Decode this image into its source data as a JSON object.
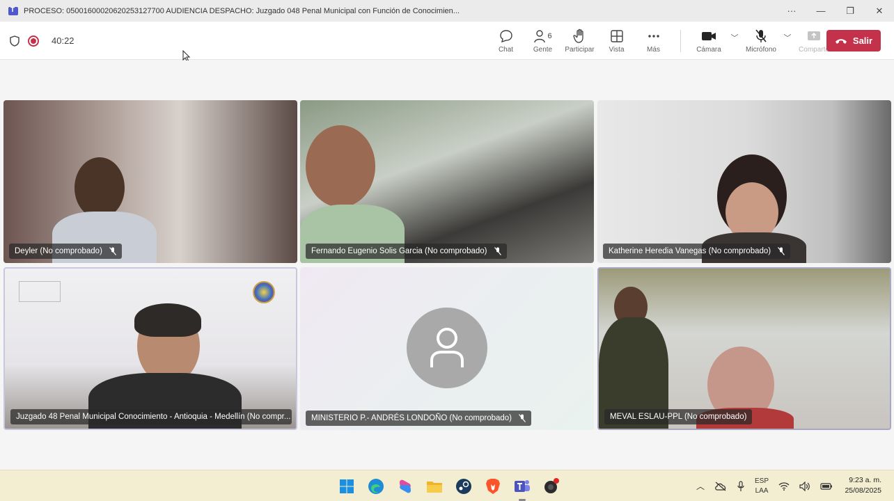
{
  "window": {
    "title": "PROCESO: 05001600020620253127700 AUDIENCIA DESPACHO: Juzgado 048 Penal Municipal con Función de Conocimien...",
    "more": "···",
    "minimize": "—",
    "maximize": "❐",
    "close": "✕"
  },
  "meeting": {
    "timer": "40:22",
    "tools": {
      "chat": "Chat",
      "people": "Gente",
      "people_count": "6",
      "raise": "Participar",
      "view": "Vista",
      "more": "Más",
      "camera": "Cámara",
      "mic": "Micrófono",
      "share": "Comparte"
    },
    "leave": "Salir"
  },
  "participants": [
    {
      "name": "Deyler (No comprobado)"
    },
    {
      "name": "Fernando Eugenio Solis Garcia (No comprobado)"
    },
    {
      "name": "Katherine Heredia Vanegas (No comprobado)"
    },
    {
      "name": "Juzgado 48 Penal Municipal Conocimiento - Antioquia - Medellín (No compr..."
    },
    {
      "name": "MINISTERIO P.- ANDRÉS LONDOÑO (No comprobado)"
    },
    {
      "name": "MEVAL ESLAU-PPL (No comprobado)"
    }
  ],
  "taskbar": {
    "lang_top": "ESP",
    "lang_bottom": "LAA",
    "time": "9:23 a. m.",
    "date": "25/08/2025"
  }
}
